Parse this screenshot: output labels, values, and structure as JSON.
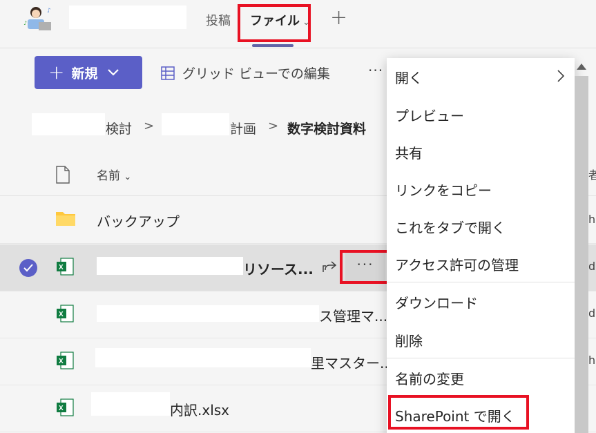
{
  "header": {
    "tabs": [
      {
        "label": "投稿"
      },
      {
        "label": "ファイル"
      }
    ],
    "add_tab_symbol": "+"
  },
  "commands": {
    "new_label": "新規",
    "grid_edit_label": "グリッド ビューでの編集",
    "more_label": "···"
  },
  "breadcrumb": {
    "items": [
      "検討",
      "計画",
      "数字検討資料"
    ]
  },
  "list": {
    "column_name": "名前",
    "rows": [
      {
        "name": "バックアップ",
        "type": "folder"
      },
      {
        "name": "リソース...",
        "type": "excel",
        "selected": true
      },
      {
        "name": "ス管理マ...",
        "type": "excel"
      },
      {
        "name": "里マスター...",
        "type": "excel"
      },
      {
        "name": "内訳.xlsx",
        "type": "excel"
      }
    ],
    "row_more_label": "···"
  },
  "context_menu": {
    "items": [
      {
        "label": "開く"
      },
      {
        "label": "プレビュー"
      },
      {
        "label": "共有"
      },
      {
        "label": "リンクをコピー"
      },
      {
        "label": "これをタブで開く"
      },
      {
        "label": "アクセス許可の管理"
      },
      {
        "label": "ダウンロード"
      },
      {
        "label": "削除"
      },
      {
        "label": "名前の変更"
      },
      {
        "label": "SharePoint で開く"
      }
    ]
  },
  "right_edge_glyphs": [
    "者",
    "h",
    "d",
    "d",
    "h"
  ],
  "colors": {
    "accent": "#5b5fc7",
    "highlight_red": "#e81123",
    "excel_green": "#107c41",
    "folder_yellow": "#ffc83d"
  }
}
